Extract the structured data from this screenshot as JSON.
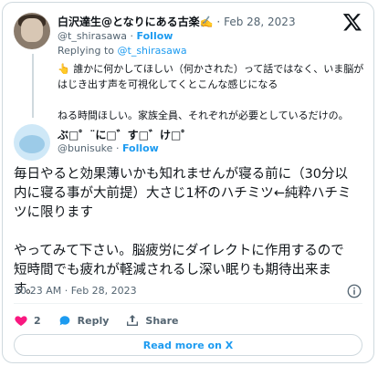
{
  "parent_tweet": {
    "display_name": "白沢達生@となりにある古楽✍️",
    "separator": "·",
    "date": "Feb 28, 2023",
    "handle": "@t_shirasawa",
    "follow_label": "Follow",
    "replying_prefix": "Replying to",
    "replying_to": "@t_shirasawa",
    "text": "👆 誰かに何かしてほしい（何かされた）って話ではなく、いま脳が\nはじき出す声を可視化してくとこんな感じになる\n\nねる時間ほしい。家族全員、それぞれが必要としているだけの。"
  },
  "main_tweet": {
    "display_name": "ぶ□゜¨に□゛す□゛け□゜",
    "handle": "@bunisuke",
    "separator": "·",
    "follow_label": "Follow",
    "text": "毎日やると効果薄いかも知れませんが寝る前に（30分以\n内に寝る事が大前提）大さじ1杯のハチミツ←純粋ハチミ\nツに限ります\n\nやってみて下さい。脳疲労にダイレクトに作用するので\n短時間でも疲れが軽減されるし深い眠りも期待出来ま\nす。",
    "timestamp": "10:23 AM · Feb 28, 2023"
  },
  "actions": {
    "like_count": "2",
    "reply_label": "Reply",
    "share_label": "Share"
  },
  "read_more_label": "Read more on X",
  "colors": {
    "accent": "#1d9bf0",
    "like": "#f91880",
    "muted": "#536471",
    "border": "#cfd9de"
  },
  "icons": [
    "x-logo-icon",
    "info-icon",
    "heart-icon",
    "reply-icon",
    "share-icon"
  ]
}
